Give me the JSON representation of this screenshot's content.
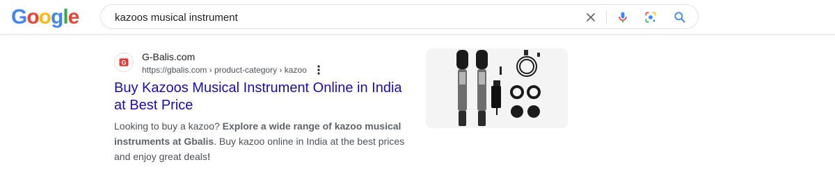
{
  "header": {
    "logo_letters": [
      {
        "char": "G",
        "color": "#4285F4"
      },
      {
        "char": "o",
        "color": "#EA4335"
      },
      {
        "char": "o",
        "color": "#FBBC05"
      },
      {
        "char": "g",
        "color": "#4285F4"
      },
      {
        "char": "l",
        "color": "#34A853"
      },
      {
        "char": "e",
        "color": "#EA4335"
      }
    ],
    "search": {
      "query": "kazoos musical instrument",
      "icons": [
        "close-icon",
        "microphone-icon",
        "lens-icon",
        "search-icon"
      ]
    }
  },
  "result": {
    "site_name": "G-Balis.com",
    "favicon_letter": "G",
    "favicon_color": "#e53935",
    "url": "https://gbalis.com › product-category › kazoo",
    "title_line1": "Buy Kazoos Musical Instrument Online in India",
    "title_line2": "at Best Price",
    "snippet": {
      "part1": "Looking to buy a kazoo? ",
      "bold1": "Explore a wide range of kazoo musical instruments at Gbalis",
      "part2": ". Buy kazoo online in India at the best prices and enjoy great deals",
      "bold2": "!"
    },
    "thumbnail_icon": "wireless-microphone-kit-image"
  },
  "colors": {
    "link": "#1a0dab",
    "snippet_text": "#4d5156"
  }
}
